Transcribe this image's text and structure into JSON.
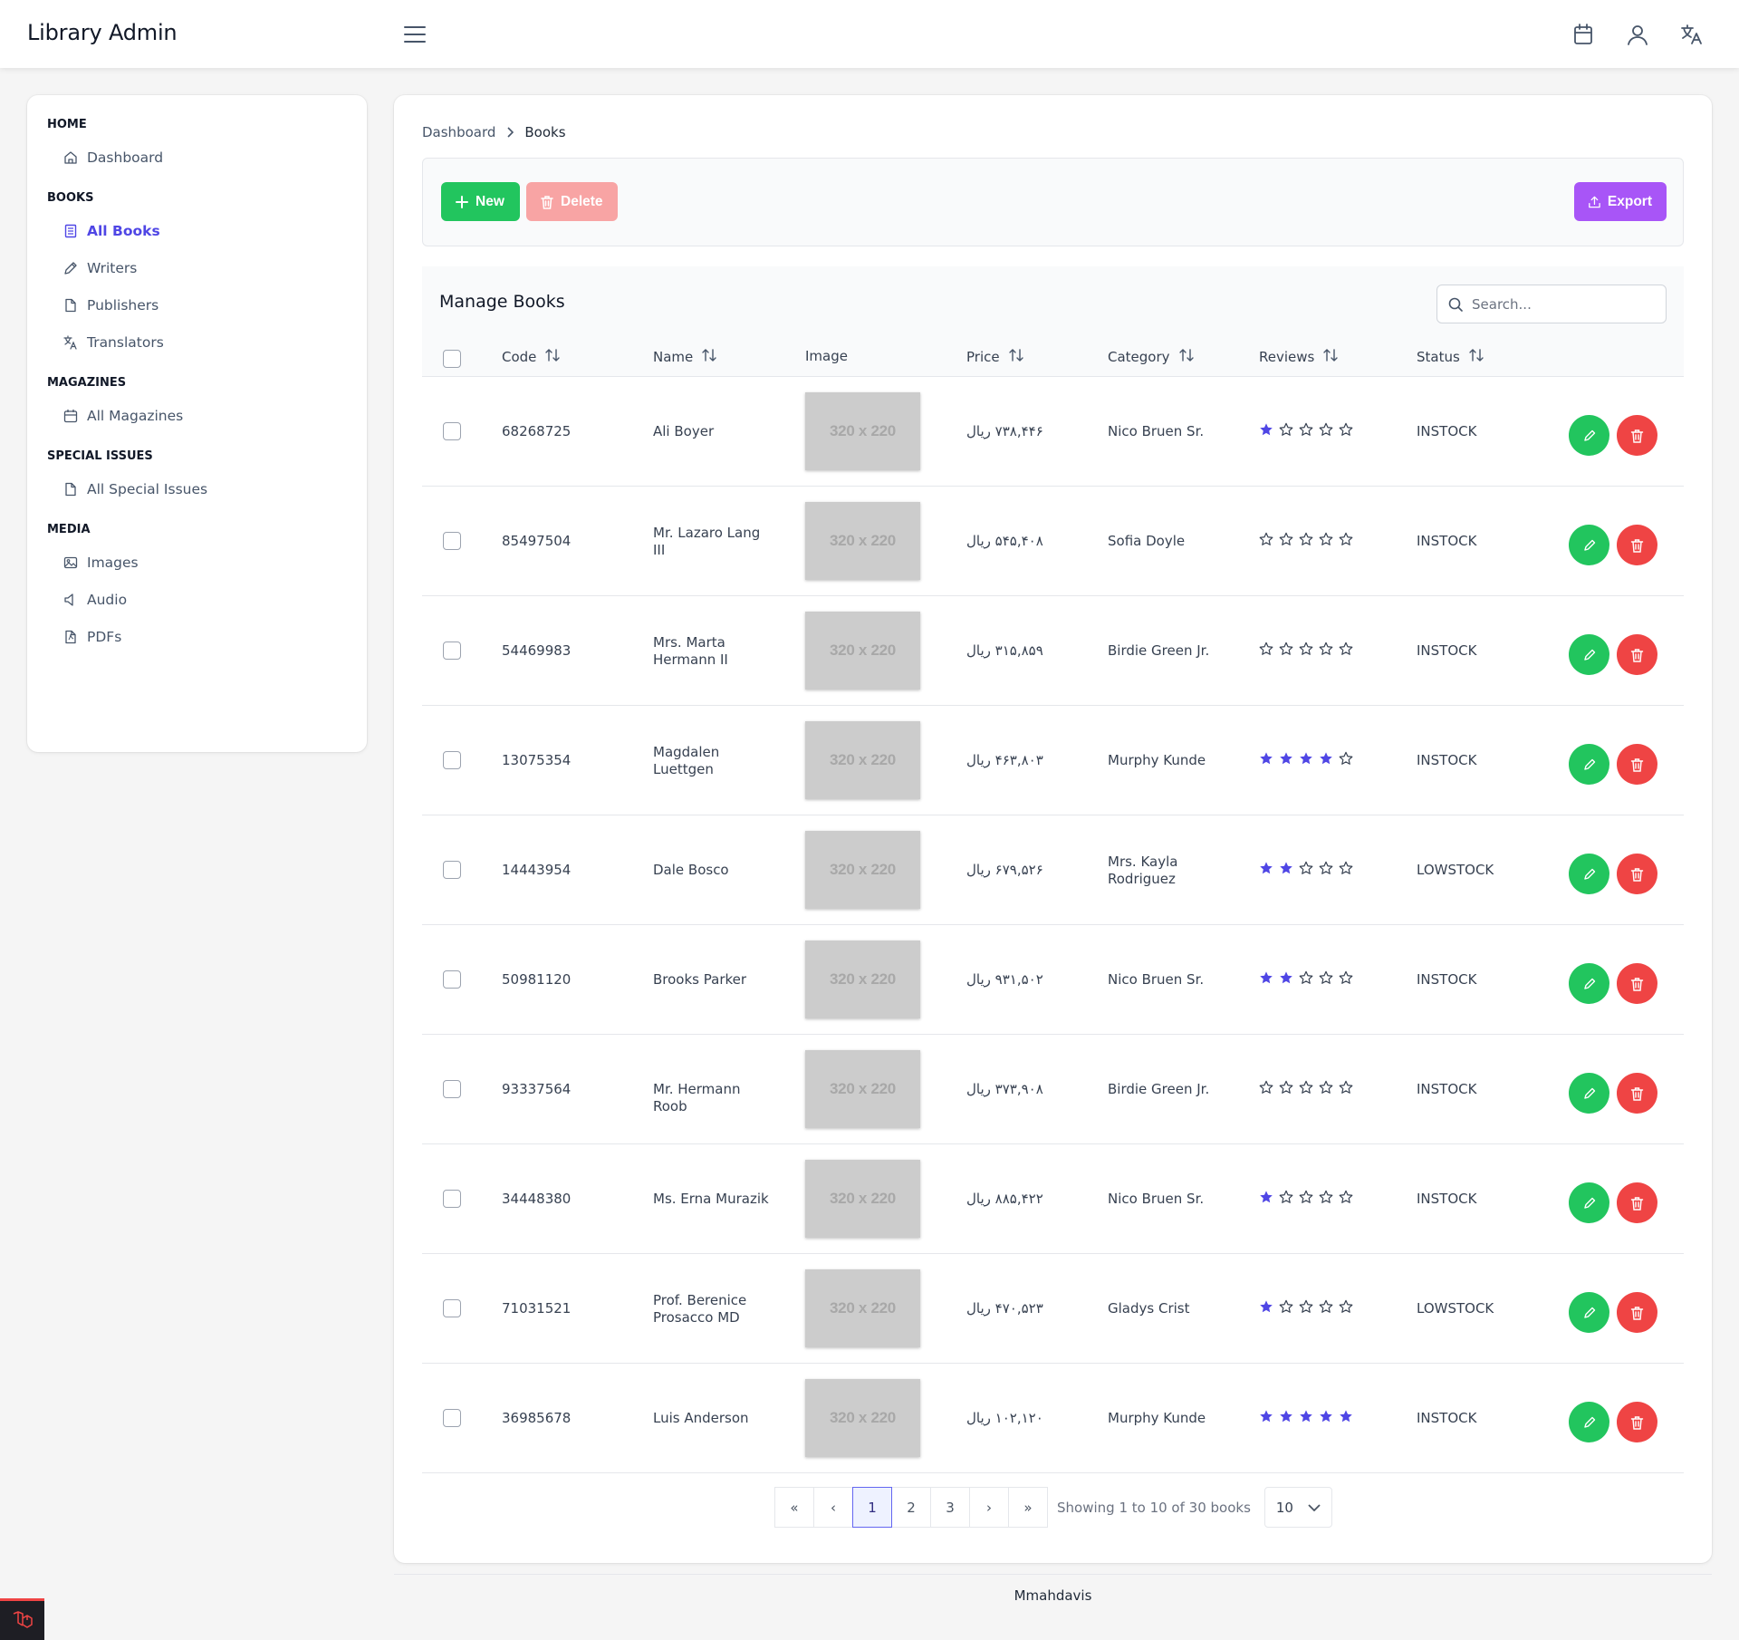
{
  "app": {
    "title": "Library Admin"
  },
  "sidebar": {
    "sections": [
      {
        "title": "HOME",
        "items": [
          {
            "label": "Dashboard",
            "icon": "home-icon"
          }
        ]
      },
      {
        "title": "BOOKS",
        "items": [
          {
            "label": "All Books",
            "icon": "book-icon",
            "active": true
          },
          {
            "label": "Writers",
            "icon": "pencil-icon"
          },
          {
            "label": "Publishers",
            "icon": "file-icon"
          },
          {
            "label": "Translators",
            "icon": "translate-icon"
          }
        ]
      },
      {
        "title": "MAGAZINES",
        "items": [
          {
            "label": "All Magazines",
            "icon": "calendar-icon"
          }
        ]
      },
      {
        "title": "SPECIAL ISSUES",
        "items": [
          {
            "label": "All Special Issues",
            "icon": "file-icon"
          }
        ]
      },
      {
        "title": "MEDIA",
        "items": [
          {
            "label": "Images",
            "icon": "image-icon"
          },
          {
            "label": "Audio",
            "icon": "speaker-icon"
          },
          {
            "label": "PDFs",
            "icon": "pdf-icon"
          }
        ]
      }
    ]
  },
  "breadcrumb": {
    "parent": "Dashboard",
    "current": "Books"
  },
  "toolbar": {
    "new_label": "New",
    "delete_label": "Delete",
    "export_label": "Export"
  },
  "table": {
    "title": "Manage Books",
    "search_placeholder": "Search...",
    "columns": {
      "code": "Code",
      "name": "Name",
      "image": "Image",
      "price": "Price",
      "category": "Category",
      "reviews": "Reviews",
      "status": "Status"
    },
    "image_placeholder": "320 x 220",
    "rows": [
      {
        "code": "68268725",
        "name": "Ali Boyer",
        "price": "۷۳۸,۴۴۶ ریال",
        "category": "Nico Bruen Sr.",
        "rating": 1,
        "status": "INSTOCK"
      },
      {
        "code": "85497504",
        "name": "Mr. Lazaro Lang III",
        "price": "۵۴۵,۴۰۸ ریال",
        "category": "Sofia Doyle",
        "rating": 0,
        "status": "INSTOCK"
      },
      {
        "code": "54469983",
        "name": "Mrs. Marta Hermann II",
        "price": "۳۱۵,۸۵۹ ریال",
        "category": "Birdie Green Jr.",
        "rating": 0,
        "status": "INSTOCK"
      },
      {
        "code": "13075354",
        "name": "Magdalen Luettgen",
        "price": "۴۶۳,۸۰۳ ریال",
        "category": "Murphy Kunde",
        "rating": 4,
        "status": "INSTOCK"
      },
      {
        "code": "14443954",
        "name": "Dale Bosco",
        "price": "۶۷۹,۵۲۶ ریال",
        "category": "Mrs. Kayla Rodriguez",
        "rating": 2,
        "status": "LOWSTOCK"
      },
      {
        "code": "50981120",
        "name": "Brooks Parker",
        "price": "۹۳۱,۵۰۲ ریال",
        "category": "Nico Bruen Sr.",
        "rating": 2,
        "status": "INSTOCK"
      },
      {
        "code": "93337564",
        "name": "Mr. Hermann Roob",
        "price": "۳۷۳,۹۰۸ ریال",
        "category": "Birdie Green Jr.",
        "rating": 0,
        "status": "INSTOCK"
      },
      {
        "code": "34448380",
        "name": "Ms. Erna Murazik",
        "price": "۸۸۵,۴۲۲ ریال",
        "category": "Nico Bruen Sr.",
        "rating": 1,
        "status": "INSTOCK"
      },
      {
        "code": "71031521",
        "name": "Prof. Berenice Prosacco MD",
        "price": "۴۷۰,۵۲۳ ریال",
        "category": "Gladys Crist",
        "rating": 1,
        "status": "LOWSTOCK"
      },
      {
        "code": "36985678",
        "name": "Luis Anderson",
        "price": "۱۰۲,۱۲۰ ریال",
        "category": "Murphy Kunde",
        "rating": 5,
        "status": "INSTOCK"
      }
    ]
  },
  "pagination": {
    "first": "«",
    "prev": "‹",
    "pages": [
      "1",
      "2",
      "3"
    ],
    "current": "1",
    "next": "›",
    "last": "»",
    "info": "Showing 1 to 10 of 30 books",
    "per_page": "10"
  },
  "footer": {
    "text": "Mmahdavis"
  },
  "colors": {
    "primary": "#4f46e5",
    "success": "#22c55e",
    "danger": "#ef4444",
    "danger_light": "#f8a4a4",
    "export": "#a855f7",
    "star": "#4f46e5"
  }
}
